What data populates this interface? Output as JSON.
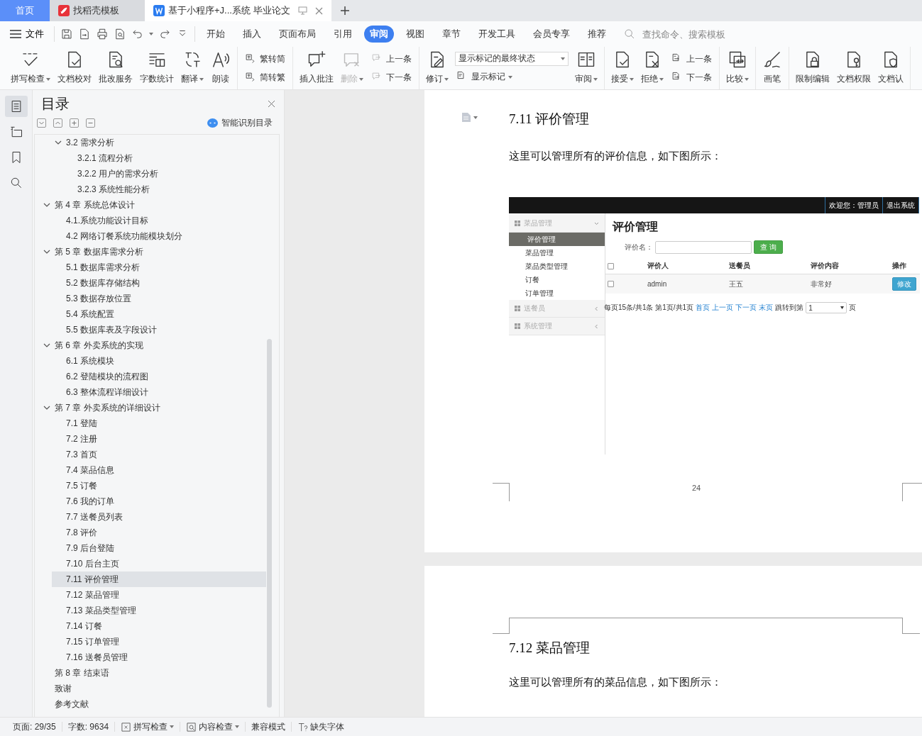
{
  "tabbar": {
    "tabs": [
      {
        "label": "首页",
        "kind": "home",
        "selected": false
      },
      {
        "label": "找稻壳模板",
        "kind": "template",
        "selected": false
      },
      {
        "label": "基于小程序+J...系统 毕业论文",
        "kind": "document",
        "selected": true
      }
    ]
  },
  "menu": {
    "file": "文件",
    "tabs": [
      {
        "label": "开始",
        "selected": false
      },
      {
        "label": "插入",
        "selected": false
      },
      {
        "label": "页面布局",
        "selected": false
      },
      {
        "label": "引用",
        "selected": false
      },
      {
        "label": "审阅",
        "selected": true
      },
      {
        "label": "视图",
        "selected": false
      },
      {
        "label": "章节",
        "selected": false
      },
      {
        "label": "开发工具",
        "selected": false
      },
      {
        "label": "会员专享",
        "selected": false
      },
      {
        "label": "推荐",
        "selected": false
      }
    ],
    "search": {
      "placeholder": "查找命令、搜索模板"
    }
  },
  "ribbon": {
    "groups": [
      {
        "items": [
          {
            "kind": "large",
            "label": "拼写检查",
            "has_menu": true,
            "disabled": false
          },
          {
            "kind": "large",
            "label": "文档校对",
            "has_menu": false,
            "disabled": false
          },
          {
            "kind": "large",
            "label": "批改服务",
            "has_menu": false,
            "disabled": false
          },
          {
            "kind": "large",
            "label": "字数统计",
            "has_menu": false,
            "disabled": false
          },
          {
            "kind": "large",
            "label": "翻译",
            "has_menu": true,
            "disabled": false
          },
          {
            "kind": "large",
            "label": "朗读",
            "has_menu": false,
            "disabled": false
          }
        ]
      },
      {
        "items": [
          {
            "kind": "stack",
            "tools": [
              {
                "kind": "small",
                "label": "繁转简",
                "has_menu": false,
                "disabled": false
              },
              {
                "kind": "small",
                "label": "简转繁",
                "has_menu": false,
                "disabled": false
              }
            ]
          }
        ]
      },
      {
        "items": [
          {
            "kind": "large",
            "label": "插入批注",
            "has_menu": false,
            "disabled": false
          },
          {
            "kind": "large",
            "label": "删除",
            "has_menu": true,
            "disabled": true
          },
          {
            "kind": "stack",
            "tools": [
              {
                "kind": "small",
                "label": "上一条",
                "has_menu": false,
                "disabled": true
              },
              {
                "kind": "small",
                "label": "下一条",
                "has_menu": false,
                "disabled": true
              }
            ]
          }
        ]
      },
      {
        "items": [
          {
            "kind": "large",
            "label": "修订",
            "has_menu": true,
            "disabled": false
          },
          {
            "kind": "stack",
            "tools": [
              {
                "kind": "select",
                "label": "显示标记的最终状态",
                "has_menu": true,
                "disabled": false
              },
              {
                "kind": "small",
                "label": "显示标记",
                "has_menu": true,
                "disabled": false
              }
            ]
          },
          {
            "kind": "large",
            "label": "审阅",
            "has_menu": true,
            "disabled": false
          }
        ]
      },
      {
        "items": [
          {
            "kind": "large",
            "label": "接受",
            "has_menu": true,
            "disabled": false
          },
          {
            "kind": "large",
            "label": "拒绝",
            "has_menu": true,
            "disabled": false
          },
          {
            "kind": "stack",
            "tools": [
              {
                "kind": "small",
                "label": "上一条",
                "has_menu": false,
                "disabled": false
              },
              {
                "kind": "small",
                "label": "下一条",
                "has_menu": false,
                "disabled": false
              }
            ]
          }
        ]
      },
      {
        "items": [
          {
            "kind": "large",
            "label": "比较",
            "has_menu": true,
            "disabled": false
          }
        ]
      },
      {
        "items": [
          {
            "kind": "large",
            "label": "画笔",
            "has_menu": false,
            "disabled": false
          }
        ]
      },
      {
        "items": [
          {
            "kind": "large",
            "label": "限制编辑",
            "has_menu": false,
            "disabled": false
          },
          {
            "kind": "large",
            "label": "文档权限",
            "has_menu": false,
            "disabled": false
          },
          {
            "kind": "large",
            "label": "文档认",
            "has_menu": false,
            "disabled": false
          }
        ]
      }
    ]
  },
  "sidebar_rail": [
    {
      "selected": true
    },
    {
      "selected": false
    },
    {
      "selected": false
    },
    {
      "selected": false
    }
  ],
  "toc": {
    "title": "目录",
    "smart_button": "智能识别目录",
    "continued": [
      {
        "label": "3.2 需求分析",
        "expanded": true,
        "selected": false,
        "children": [
          {
            "label": "3.2.1 流程分析",
            "selected": false
          },
          {
            "label": "3.2.2 用户的需求分析",
            "selected": false
          },
          {
            "label": "3.2.3 系统性能分析",
            "selected": false
          }
        ]
      }
    ],
    "items": [
      {
        "label": "第 4 章  系统总体设计",
        "expanded": true,
        "selected": false,
        "children": [
          {
            "label": "4.1.系统功能设计目标",
            "selected": false
          },
          {
            "label": "4.2  网络订餐系统功能模块划分",
            "selected": false
          }
        ]
      },
      {
        "label": "第 5 章  数据库需求分析",
        "expanded": true,
        "selected": false,
        "children": [
          {
            "label": "5.1 数据库需求分析",
            "selected": false
          },
          {
            "label": "5.2 数据库存储结构",
            "selected": false
          },
          {
            "label": "5.3  数据存放位置",
            "selected": false
          },
          {
            "label": "5.4  系统配置",
            "selected": false
          },
          {
            "label": "5.5 数据库表及字段设计",
            "selected": false
          }
        ]
      },
      {
        "label": "第 6 章  外卖系统的实现",
        "expanded": true,
        "selected": false,
        "children": [
          {
            "label": "6.1  系统模块",
            "selected": false
          },
          {
            "label": "6.2  登陆模块的流程图",
            "selected": false
          },
          {
            "label": "6.3  整体流程详细设计",
            "selected": false
          }
        ]
      },
      {
        "label": "第 7 章  外卖系统的详细设计",
        "expanded": true,
        "selected": false,
        "children": [
          {
            "label": "7.1 登陆",
            "selected": false
          },
          {
            "label": "7.2 注册",
            "selected": false
          },
          {
            "label": "7.3 首页",
            "selected": false
          },
          {
            "label": "7.4 菜品信息",
            "selected": false
          },
          {
            "label": "7.5 订餐",
            "selected": false
          },
          {
            "label": "7.6 我的订单",
            "selected": false
          },
          {
            "label": "7.7 送餐员列表",
            "selected": false
          },
          {
            "label": "7.8 评价",
            "selected": false
          },
          {
            "label": "7.9  后台登陆",
            "selected": false
          },
          {
            "label": "7.10  后台主页",
            "selected": false
          },
          {
            "label": "7.11 评价管理",
            "selected": true
          },
          {
            "label": "7.12 菜品管理",
            "selected": false
          },
          {
            "label": "7.13 菜品类型管理",
            "selected": false
          },
          {
            "label": "7.14 订餐",
            "selected": false
          },
          {
            "label": "7.15 订单管理",
            "selected": false
          },
          {
            "label": "7.16 送餐员管理",
            "selected": false
          }
        ]
      },
      {
        "label": "第 8 章  结束语",
        "selected": false
      },
      {
        "label": "致谢",
        "selected": false
      },
      {
        "label": "参考文献",
        "selected": false
      }
    ]
  },
  "document": {
    "pages": [
      {
        "heading": "7.11 评价管理",
        "paragraph": "这里可以管理所有的评价信息，如下图所示：",
        "page_number": "24",
        "figure": {
          "header_items": [
            "欢迎您：管理员",
            "退出系统"
          ],
          "menu_groups": [
            {
              "label": "菜品管理",
              "expanded": true,
              "items": [
                {
                  "label": "评价管理",
                  "selected": true
                },
                {
                  "label": "菜品管理",
                  "selected": false
                },
                {
                  "label": "菜品类型管理",
                  "selected": false
                },
                {
                  "label": "订餐",
                  "selected": false
                },
                {
                  "label": "订单管理",
                  "selected": false
                }
              ]
            },
            {
              "label": "送餐员",
              "expanded": false
            },
            {
              "label": "系统管理",
              "expanded": false
            }
          ],
          "title": "评价管理",
          "filter_label": "评价名：",
          "search_button": "查 询",
          "select_all_checked": false,
          "columns": [
            "评价人",
            "送餐员",
            "评价内容",
            "操作"
          ],
          "rows": [
            {
              "checked": false,
              "cells": [
                "admin",
                "王五",
                "非常好"
              ],
              "action": "修改"
            }
          ],
          "pager": {
            "summary": "每页15条/共1条 第1页/共1页",
            "links": [
              "首页",
              "上一页",
              "下一页",
              "末页"
            ],
            "jump_label": "跳转到第",
            "page_value": "1",
            "unit": "页"
          }
        }
      },
      {
        "heading": "7.12 菜品管理",
        "paragraph": "这里可以管理所有的菜品信息，如下图所示："
      }
    ]
  },
  "status_bar": {
    "items": [
      {
        "kind": "text",
        "label": "页面: 29/35"
      },
      {
        "kind": "text",
        "label": "字数: 9634"
      },
      {
        "kind": "spell",
        "label": "拼写检查",
        "has_menu": true
      },
      {
        "kind": "content",
        "label": "内容检查",
        "has_menu": true
      },
      {
        "kind": "text",
        "label": "兼容模式"
      },
      {
        "kind": "font",
        "label": "缺失字体",
        "has_menu": false
      }
    ]
  }
}
